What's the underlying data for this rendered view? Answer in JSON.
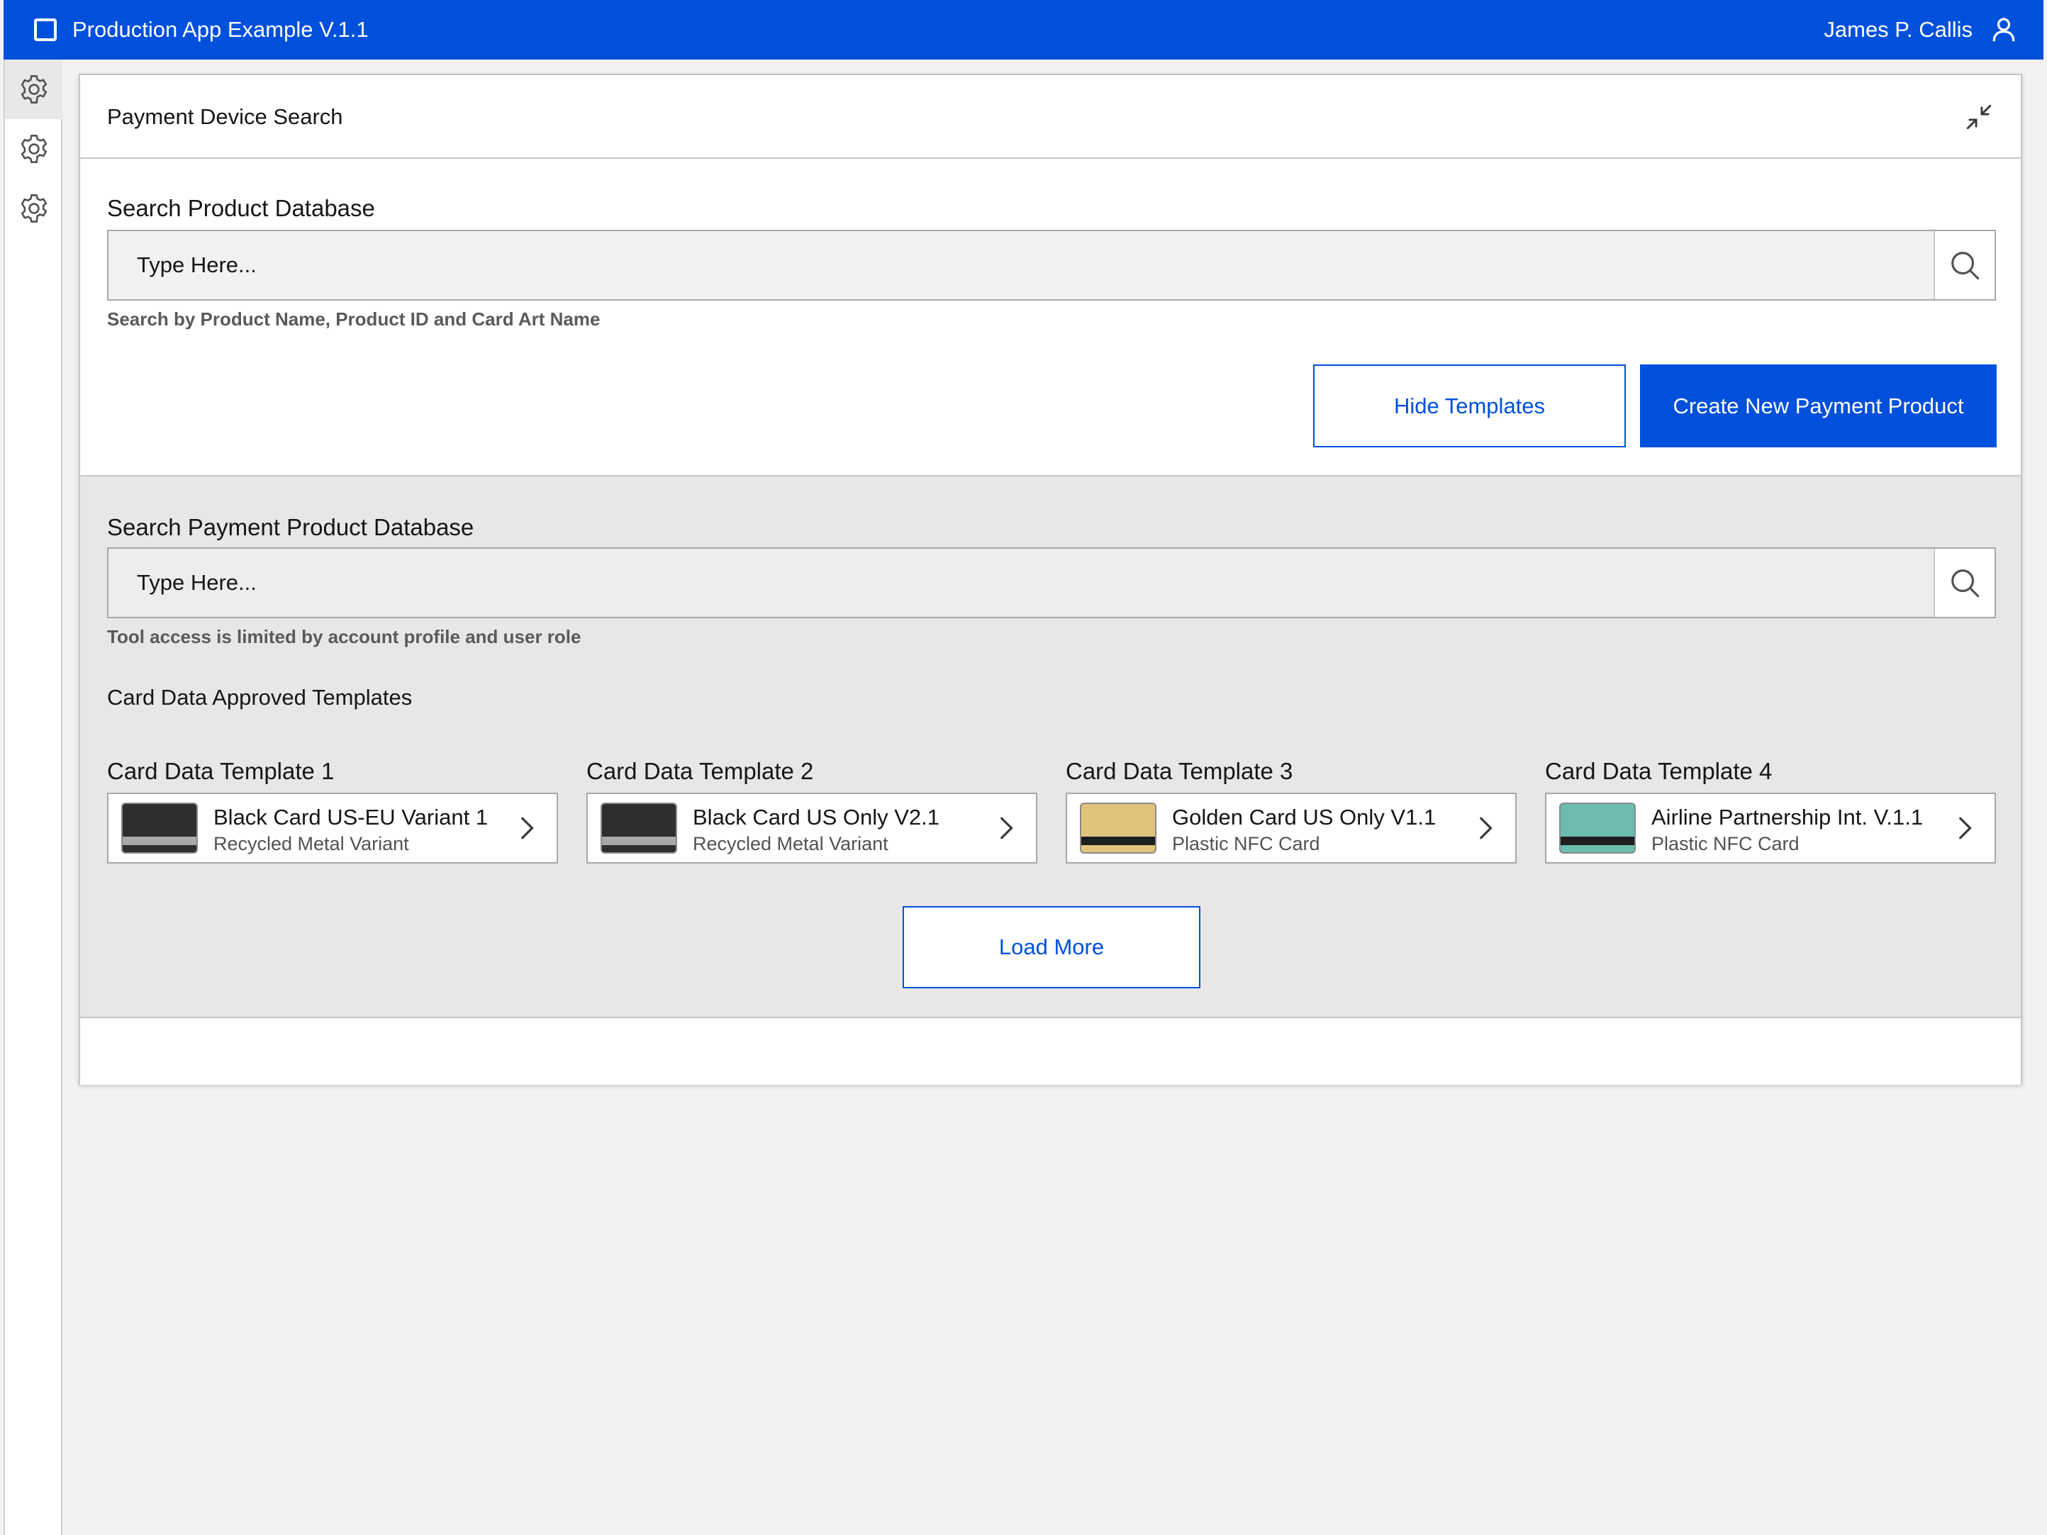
{
  "topbar": {
    "app_title": "Production App Example V.1.1",
    "user_name": "James P. Callis",
    "brand_color": "#0050dc"
  },
  "sidebar": {
    "items": [
      {
        "icon": "gear-icon",
        "active": true
      },
      {
        "icon": "gear-icon",
        "active": false
      },
      {
        "icon": "gear-icon",
        "active": false
      }
    ]
  },
  "panel": {
    "title": "Payment Device Search",
    "product_search": {
      "label": "Search Product Database",
      "placeholder": "Type Here...",
      "helper": "Search by Product Name, Product ID and Card Art Name"
    },
    "buttons": {
      "hide_templates": "Hide Templates",
      "create_new": "Create New Payment Product"
    },
    "payment_search": {
      "label": "Search Payment Product Database",
      "placeholder": "Type Here...",
      "helper": "Tool access is limited by account profile and user role"
    },
    "templates_heading": "Card Data Approved Templates",
    "templates": [
      {
        "label": "Card Data Template 1",
        "title": "Black Card US-EU Variant 1",
        "subtitle": "Recycled Metal Variant",
        "card_color": "#2e2e2e",
        "stripe_color": "#a8a8a8"
      },
      {
        "label": "Card Data Template 2",
        "title": "Black Card US Only V2.1",
        "subtitle": "Recycled Metal Variant",
        "card_color": "#2e2e2e",
        "stripe_color": "#a8a8a8"
      },
      {
        "label": "Card Data Template 3",
        "title": "Golden Card US Only V1.1",
        "subtitle": "Plastic NFC Card",
        "card_color": "#e0c47e",
        "stripe_color": "#1e1e1e"
      },
      {
        "label": "Card Data Template 4",
        "title": "Airline Partnership Int. V.1.1",
        "subtitle": "Plastic NFC Card",
        "card_color": "#6cbcaf",
        "stripe_color": "#1e1e1e"
      }
    ],
    "load_more": "Load More"
  }
}
